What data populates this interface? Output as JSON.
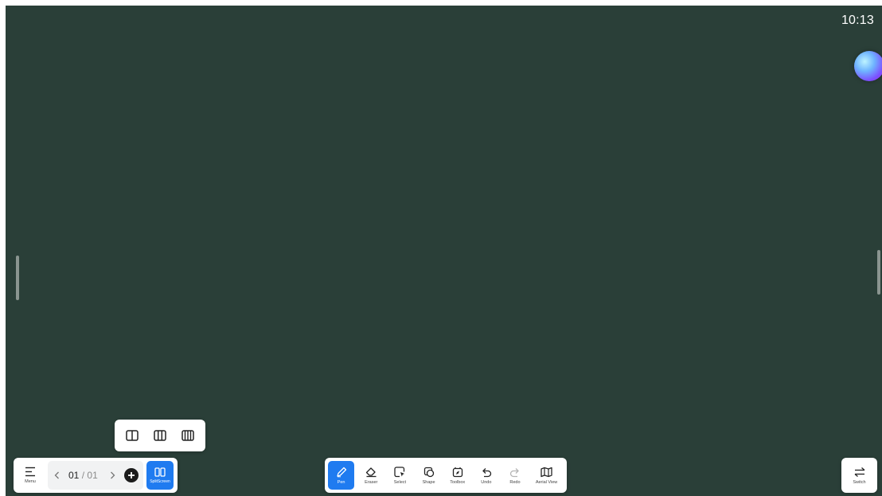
{
  "status": {
    "time": "10:13"
  },
  "split_options": [
    {
      "icon": "split-two-columns-icon"
    },
    {
      "icon": "split-three-columns-icon"
    },
    {
      "icon": "split-four-columns-icon"
    }
  ],
  "left_bar": {
    "menu_label": "Menu",
    "page_current": "01",
    "page_separator": "/",
    "page_total": "01",
    "split_label": "SplitScreen"
  },
  "toolbar": {
    "tools": [
      {
        "label": "Pen",
        "icon": "pen-icon",
        "active": true
      },
      {
        "label": "Eraser",
        "icon": "eraser-icon"
      },
      {
        "label": "Select",
        "icon": "select-icon"
      },
      {
        "label": "Shape",
        "icon": "shape-icon"
      },
      {
        "label": "Toolbox",
        "icon": "toolbox-icon"
      },
      {
        "label": "Undo",
        "icon": "undo-icon"
      },
      {
        "label": "Redo",
        "icon": "redo-icon"
      },
      {
        "label": "Aerial View",
        "icon": "aerial-view-icon"
      }
    ]
  },
  "switch": {
    "label": "Switch"
  },
  "colors": {
    "board": "#2a3f38",
    "accent": "#1f7bf0",
    "panel": "#ffffff"
  }
}
